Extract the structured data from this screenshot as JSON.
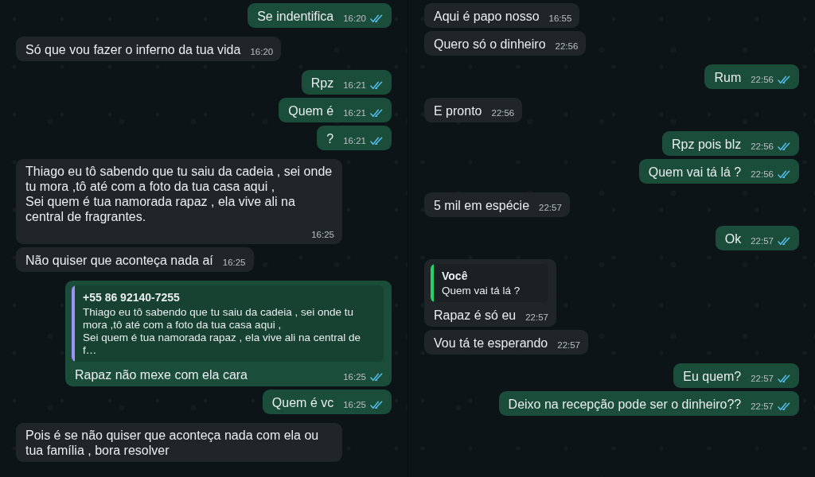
{
  "panels": [
    {
      "messages": [
        {
          "outgoing": true,
          "text": "Se indentifica",
          "time": "16:20",
          "read": true
        },
        {
          "outgoing": false,
          "text": "Só que vou fazer o inferno da tua vida",
          "time": "16:20"
        },
        {
          "outgoing": true,
          "text": "Rpz",
          "time": "16:21",
          "read": true
        },
        {
          "outgoing": true,
          "text": "Quem é",
          "time": "16:21",
          "read": true
        },
        {
          "outgoing": true,
          "text": "?",
          "time": "16:21",
          "read": true
        },
        {
          "outgoing": false,
          "text": "Thiago eu tô sabendo que tu saiu da cadeia , sei onde tu mora ,tô até com a foto da tua casa aqui ,\nSei quem é tua namorada rapaz , ela vive ali na central de fragrantes.",
          "time": "16:25"
        },
        {
          "outgoing": false,
          "text": "Não quiser que aconteça nada aí",
          "time": "16:25"
        },
        {
          "outgoing": true,
          "quote": {
            "author": "+55 86 92140-7255",
            "text": "Thiago eu tô sabendo que tu saiu da cadeia , sei onde tu mora ,tô até com a foto da tua casa aqui ,\nSei quem é tua namorada rapaz , ela vive ali na central de f…",
            "color": "#a18ff5"
          },
          "text": "Rapaz não mexe com ela cara",
          "time": "16:25",
          "read": true
        },
        {
          "outgoing": true,
          "text": "Quem é vc",
          "time": "16:25",
          "read": true
        },
        {
          "outgoing": false,
          "text": "Pois é se não quiser que aconteça nada com ela ou tua família , bora resolver"
        }
      ]
    },
    {
      "messages": [
        {
          "outgoing": false,
          "text": "Aqui é papo nosso",
          "time": "16:55"
        },
        {
          "outgoing": false,
          "text": "Quero só o dinheiro",
          "time": "22:56"
        },
        {
          "outgoing": true,
          "text": "Rum",
          "time": "22:56",
          "read": true
        },
        {
          "outgoing": false,
          "text": "E pronto",
          "time": "22:56"
        },
        {
          "outgoing": true,
          "text": "Rpz pois blz",
          "time": "22:56",
          "read": true
        },
        {
          "outgoing": true,
          "text": "Quem vai tá lá ?",
          "time": "22:56",
          "read": true
        },
        {
          "outgoing": false,
          "text": "5 mil em espécie",
          "time": "22:57"
        },
        {
          "outgoing": true,
          "text": "Ok",
          "time": "22:57",
          "read": true
        },
        {
          "outgoing": false,
          "quote": {
            "author": "Você",
            "text": "Quem vai tá lá ?",
            "color": "#25d366"
          },
          "text": "Rapaz é só eu",
          "time": "22:57"
        },
        {
          "outgoing": false,
          "text": "Vou tá te esperando",
          "time": "22:57"
        },
        {
          "outgoing": true,
          "text": "Eu quem?",
          "time": "22:57",
          "read": true
        },
        {
          "outgoing": true,
          "text": "Deixo na recepção pode ser o dinheiro??",
          "time": "22:57",
          "read": true
        }
      ]
    }
  ]
}
